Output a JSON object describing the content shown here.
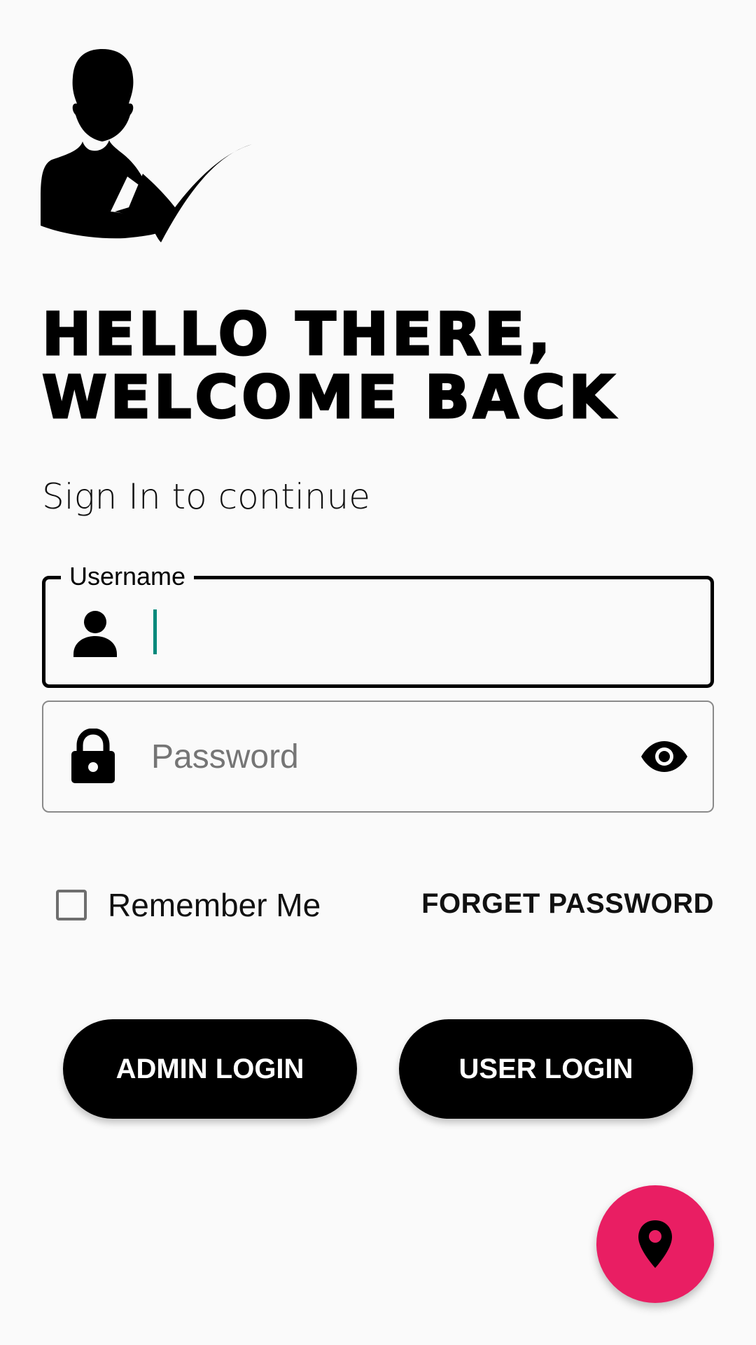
{
  "header": {
    "logo_icon": "user-check-icon",
    "headline_line1": "HELLO THERE,",
    "headline_line2": "WELCOME BACK",
    "subtitle": "Sign In to continue"
  },
  "form": {
    "username": {
      "label": "Username",
      "value": "",
      "icon": "person-icon"
    },
    "password": {
      "placeholder": "Password",
      "value": "",
      "icon": "lock-icon",
      "toggle_icon": "eye-icon"
    },
    "remember_me": {
      "label": "Remember Me",
      "checked": false
    },
    "forget_password_label": "FORGET PASSWORD"
  },
  "actions": {
    "admin_login_label": "ADMIN LOGIN",
    "user_login_label": "USER LOGIN"
  },
  "fab": {
    "icon": "location-pin-icon"
  },
  "colors": {
    "background": "#fafafa",
    "primary": "#000000",
    "accent": "#e91e63",
    "cursor": "#00897b"
  }
}
